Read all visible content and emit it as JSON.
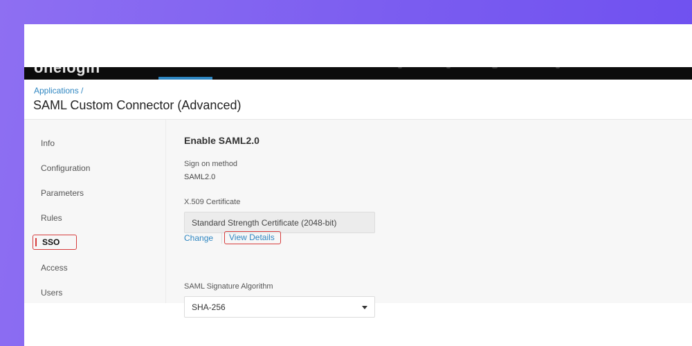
{
  "app": {
    "logo_text": "onelogin"
  },
  "header": {
    "breadcrumb": "Applications /",
    "title": "SAML Custom Connector (Advanced)"
  },
  "sidebar": {
    "items": [
      {
        "label": "Info"
      },
      {
        "label": "Configuration"
      },
      {
        "label": "Parameters"
      },
      {
        "label": "Rules"
      },
      {
        "label": "SSO"
      },
      {
        "label": "Access"
      },
      {
        "label": "Users"
      }
    ],
    "active_item": "SSO"
  },
  "main": {
    "section_title": "Enable SAML2.0",
    "sign_on": {
      "label": "Sign on method",
      "value": "SAML2.0"
    },
    "certificate": {
      "label": "X.509 Certificate",
      "value": "Standard Strength Certificate (2048-bit)",
      "change_label": "Change",
      "view_details_label": "View Details"
    },
    "signature_algorithm": {
      "label": "SAML Signature Algorithm",
      "selected": "SHA-256"
    }
  },
  "colors": {
    "accent_link": "#2e86c1",
    "highlight": "#d63b3b",
    "nav_bg": "#0c0c0c"
  }
}
